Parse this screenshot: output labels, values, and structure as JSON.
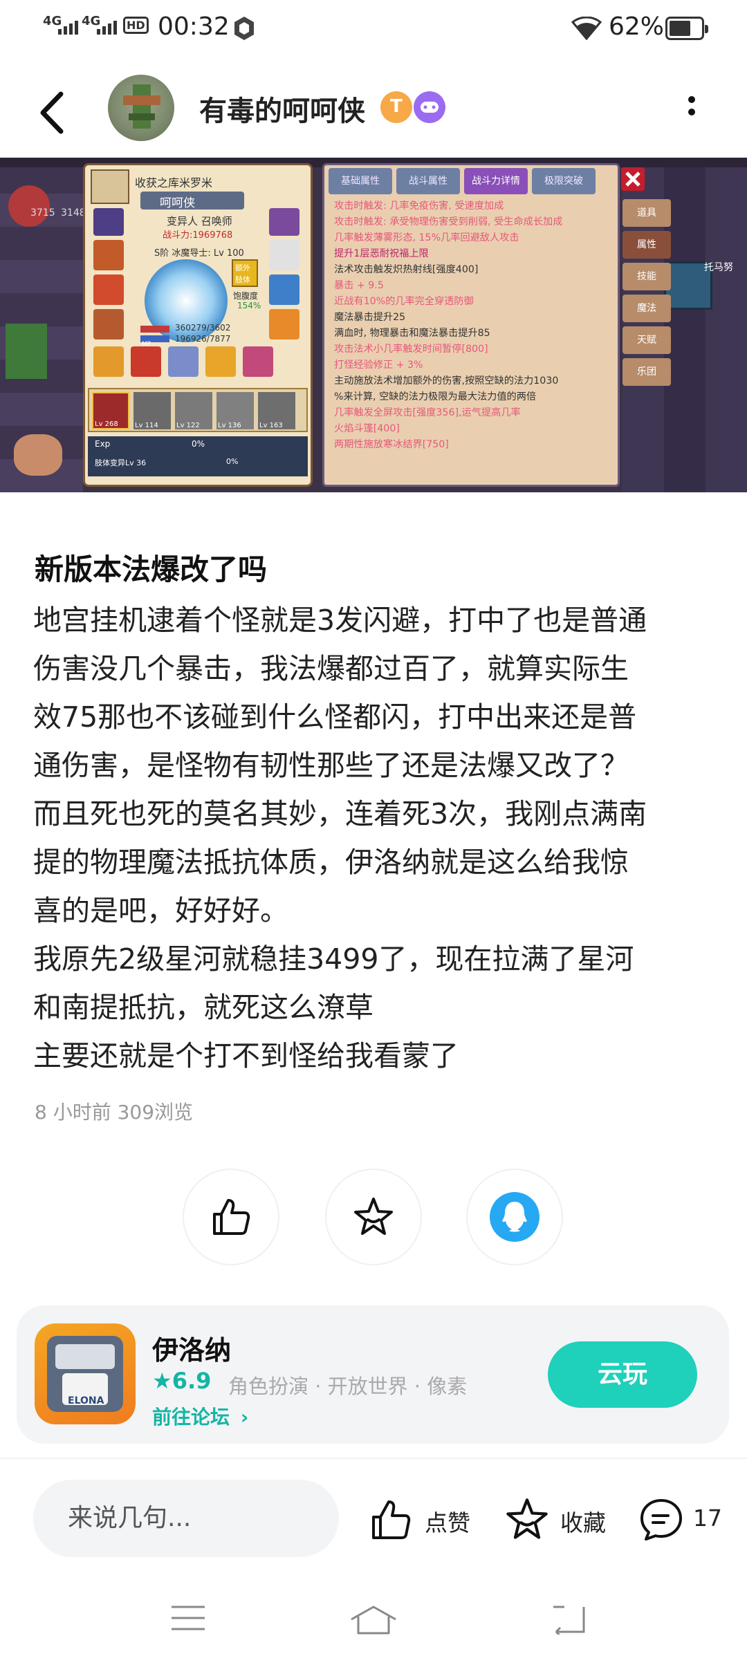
{
  "status_bar": {
    "net1": "4G",
    "net2": "4G",
    "hd": "HD",
    "time": "00:32",
    "battery": "62%"
  },
  "header": {
    "username": "有毒的呵呵侠",
    "badge1_icon": "t-badge-icon",
    "badge2_icon": "gamepad-badge-icon"
  },
  "game_screenshot": {
    "char_panel": {
      "title": "收获之库米罗米",
      "name": "呵呵侠",
      "job": "变异人 召唤师",
      "power": "战斗力:1969768",
      "rank": "S阶 冰魔导士: Lv 100",
      "extra": "额外肢体",
      "satiety": "饱腹度",
      "satiety_pct": "154%",
      "hp": "360279/3602",
      "mp": "196926/7877",
      "exp": "Exp",
      "exp_pct": "0%",
      "limb": "肢体变异Lv 36",
      "limb_pct": "0%",
      "pets": [
        "Lv 268",
        "Lv 114",
        "Lv 122",
        "Lv 136",
        "Lv 163"
      ]
    },
    "tabs": [
      "基础属性",
      "战斗属性",
      "战斗力详情",
      "极限突破"
    ],
    "side_tabs": [
      "道具",
      "属性",
      "技能",
      "魔法",
      "天赋",
      "乐团"
    ],
    "stats": [
      "攻击时触发: 几率免疫伤害, 受速度加成",
      "攻击时触发: 承受物理伤害受到削弱, 受生命成长加成",
      "几率触发薄雾形态, 15%几率回避敌人攻击",
      "提升1层恶耐祝福上限",
      "法术攻击触发炽热射线[强度400]",
      "暴击 + 9.5",
      "近战有10%的几率完全穿透防御",
      "魔法暴击提升25",
      "满血时, 物理暴击和魔法暴击提升85",
      "攻击法术小几率触发时间暂停[800]",
      "打怪经验修正 + 3%",
      "主动施放法术增加额外的伤害,按照空缺的法力1030",
      "%来计算, 空缺的法力极限为最大法力值的两倍",
      "几率触发全屏攻击[强度356],运气提高几率",
      "火焰斗篷[400]",
      "两期性施放寒冰结界[750]"
    ],
    "map_labels": [
      "托马努",
      "3715",
      "3148"
    ]
  },
  "post": {
    "title": "新版本法爆改了吗",
    "lines": [
      "地宫挂机逮着个怪就是3发闪避，打中了也是普通",
      "伤害没几个暴击，我法爆都过百了，就算实际生",
      "效75那也不该碰到什么怪都闪，打中出来还是普",
      "通伤害，是怪物有韧性那些了还是法爆又改了？",
      "而且死也死的莫名其妙，连着死3次，我刚点满南",
      "提的物理魔法抵抗体质，伊洛纳就是这么给我惊",
      "喜的是吧，好好好。",
      "我原先2级星河就稳挂3499了，现在拉满了星河",
      "和南提抵抗，就死这么潦草",
      "主要还就是个打不到怪给我看蒙了"
    ],
    "meta": "8 小时前  309浏览"
  },
  "game_card": {
    "name": "伊洛纳",
    "rating": "6.9",
    "tags": "角色扮演 · 开放世界 · 像素",
    "forum": "前往论坛",
    "icon_text": "ELONA",
    "cloud_play": "云玩"
  },
  "bottom_bar": {
    "input_placeholder": "来说几句...",
    "like": "点赞",
    "favorite": "收藏",
    "comments": "17"
  },
  "colors": {
    "accent": "#1fd0bb",
    "accent_text": "#12b6a4",
    "qq_blue": "#26a8f3"
  }
}
